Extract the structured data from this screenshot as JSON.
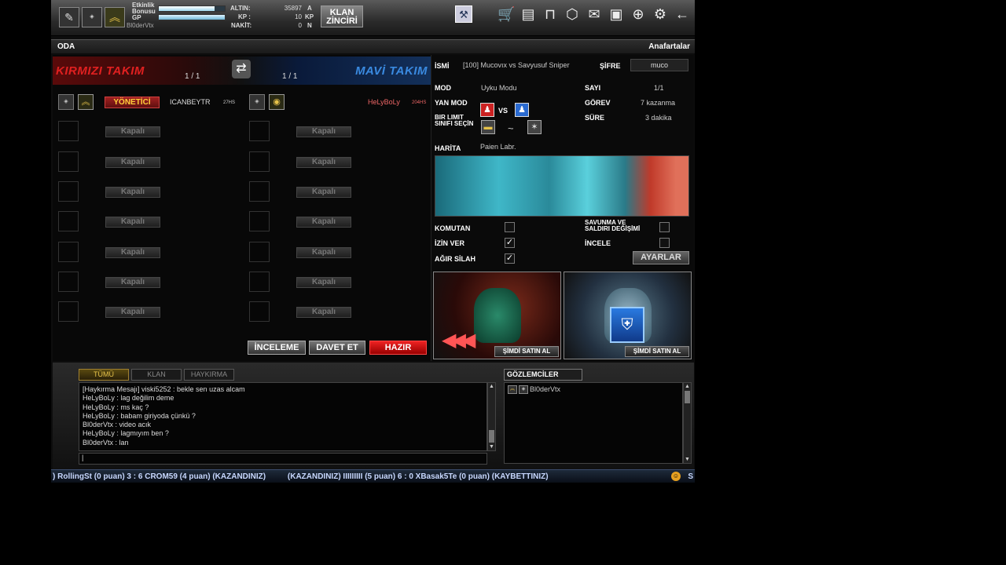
{
  "topbar": {
    "event_bonus_label": "Etkinlik Bonusu",
    "gp_label": "GP",
    "username": "Bl0derVtx",
    "altin_label": "ALTIN:",
    "altin_value": "35897",
    "altin_unit": "A",
    "kp_label": "KP :",
    "kp_value": "10",
    "kp_unit": "KP",
    "nakit_label": "NAKİT:",
    "nakit_value": "0",
    "nakit_unit": "N",
    "klan_button_line1": "KLAN",
    "klan_button_line2": "ZİNCİRİ",
    "event_bonus_progress": 0.85,
    "gp_progress": 1.0
  },
  "room": {
    "header_title": "ODA",
    "header_right": "Anafartalar",
    "name_label": "İSMİ",
    "name_value": "[100] Mucovıx vs Savyusuf Sniper",
    "password_label": "ŞİFRE",
    "password_value": "muco",
    "mode_label": "MOD",
    "mode_value": "Uyku Modu",
    "count_label": "SAYI",
    "count_value": "1/1",
    "side_mode_label": "YAN MOD",
    "mission_label": "GÖREV",
    "mission_value": "7 kazanma",
    "vs_text": "VS",
    "class_limit_label_1": "BIR LIMIT",
    "class_limit_label_2": "SINIFI SEÇİN",
    "tilde": "~",
    "duration_label": "SÜRE",
    "duration_value": "3 dakika",
    "map_label": "HARİTA",
    "map_value": "Paien Labr.",
    "komutan_label": "KOMUTAN",
    "komutan_checked": false,
    "defense_attack_label_1": "SAVUNMA VE",
    "defense_attack_label_2": "SALDIRI DEĞİŞİMİ",
    "defense_attack_checked": false,
    "allow_label": "İZİN VER",
    "allow_checked": true,
    "inspect_label": "İNCELE",
    "inspect_checked": false,
    "heavy_weapon_label": "AĞIR SİLAH",
    "heavy_weapon_checked": true,
    "settings_button": "AYARLAR",
    "check_mark": "✓"
  },
  "teams": {
    "red_name": "KIRMIZI TAKIM",
    "red_count": "1 / 1",
    "blue_name": "MAVİ TAKIM",
    "blue_count": "1 / 1",
    "red_player": {
      "badge": "Y",
      "admin_label": "YÖNETİCİ",
      "name": "ICANBEYTR",
      "hs": "27HS"
    },
    "blue_player": {
      "name": "HeLyBoLy",
      "hs": "204HS"
    },
    "closed_label": "Kapalı",
    "buttons": {
      "inspect": "İNCELEME",
      "invite": "DAVET ET",
      "ready": "HAZIR"
    }
  },
  "promos": {
    "buy_label_1": "ŞİMDİ SATIN AL",
    "buy_label_2": "ŞİMDİ SATIN AL"
  },
  "chat": {
    "tabs": [
      "TÜMÜ",
      "KLAN",
      "HAYKIRMA"
    ],
    "lines": [
      "[Haykırma Mesajı] viski5252 : bekle sen uzas alcam",
      "HeLyBoLy : lag değilim deme",
      "HeLyBoLy : ms kaç ?",
      "HeLyBoLy : babam giriyoda çünkü ?",
      "Bl0derVtx : video acık",
      "HeLyBoLy : lagmıyım ben ?",
      "Bl0derVtx : lan"
    ],
    "input_value": "|"
  },
  "observers": {
    "title": "GÖZLEMCİLER",
    "items": [
      {
        "name": "Bl0derVtx"
      }
    ]
  },
  "ticker": {
    "text": ") RollingSt (0 puan) 3 : 6 CROM59 (4 puan) (KAZANDINIZ)          (KAZANDINIZ) IIIIIIIII (5 puan) 6 : 0 XBasak5Te (0 puan) (KAYBETTINIZ)",
    "end": "S"
  },
  "icons": {
    "top_left": [
      "notepad-icon",
      "clan-badge-icon",
      "rank-chevron-icon"
    ],
    "toolbar": [
      "wrench-icon",
      "cart-icon",
      "inventory-icon",
      "map-book-icon",
      "box-icon",
      "mail-icon",
      "community-icon",
      "search-globe-icon",
      "gear-icon",
      "back-arrow-icon"
    ]
  },
  "colors": {
    "red_team": "#e02020",
    "blue_team": "#3a8ae0",
    "admin_text": "#ffcf3a",
    "ticker_text": "#c8d8ff"
  }
}
